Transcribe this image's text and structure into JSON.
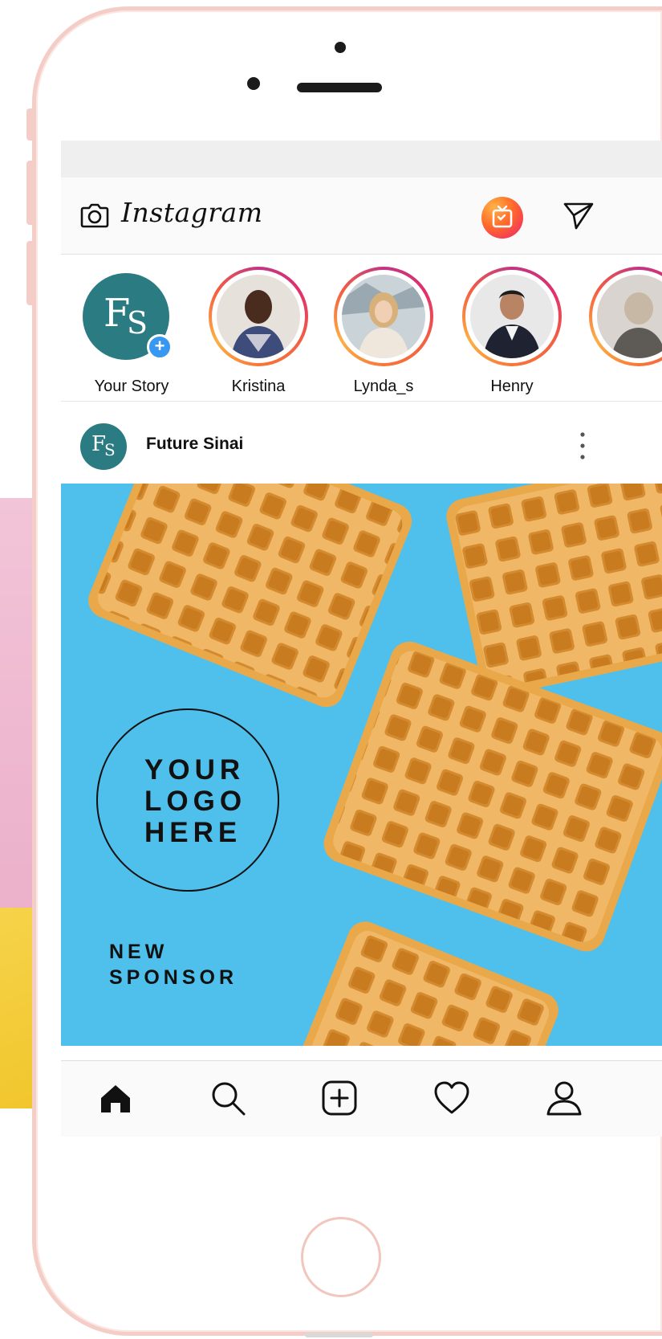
{
  "app": {
    "title": "Instagram"
  },
  "stories": [
    {
      "label": "Your Story",
      "initials_f": "F",
      "initials_s": "S",
      "badge": "+"
    },
    {
      "label": "Kristina"
    },
    {
      "label": "Lynda_s"
    },
    {
      "label": "Henry"
    }
  ],
  "post": {
    "username": "Future Sinai",
    "avatar_initials_f": "F",
    "avatar_initials_s": "S",
    "image_text": {
      "logo_line1": "YOUR",
      "logo_line2": "LOGO",
      "logo_line3": "HERE",
      "sponsor_line1": "NEW",
      "sponsor_line2": "SPONSOR"
    }
  },
  "icons": {
    "top_left": "camera-icon",
    "top_right_1": "igtv-icon",
    "top_right_2": "direct-message-icon",
    "post_menu": "more-options-icon",
    "nav": [
      "home-icon",
      "search-icon",
      "new-post-icon",
      "activity-heart-icon",
      "profile-icon"
    ]
  },
  "colors": {
    "brand_teal": "#2a7b82",
    "post_background": "#4fc0ec",
    "story_ring": "#e1306c",
    "badge_blue": "#3897f0",
    "phone_frame": "#f4cdc6"
  }
}
